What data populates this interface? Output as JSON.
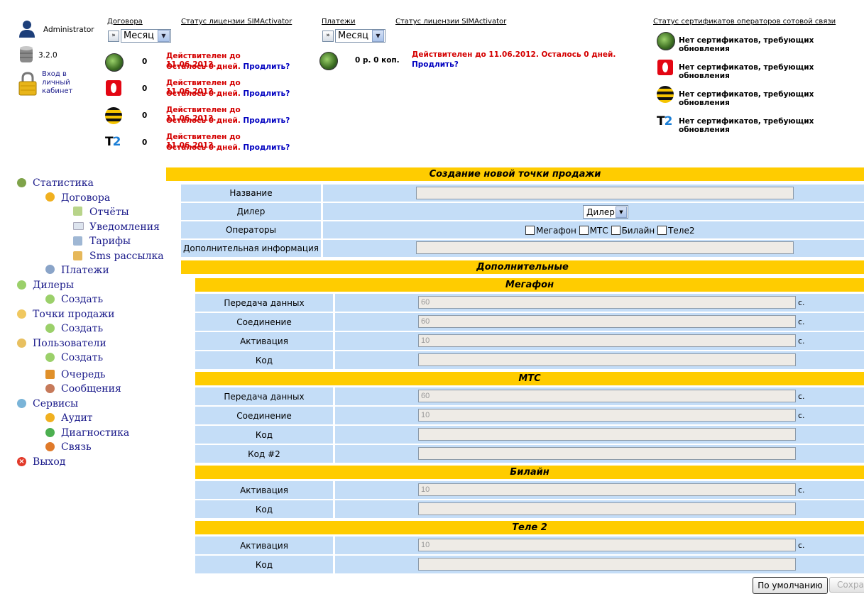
{
  "user": {
    "name": "Administrator",
    "version": "3.2.0",
    "cabinet_link": [
      "Вход в",
      "личный",
      "кабинет"
    ]
  },
  "contracts": {
    "title": "Договора",
    "license_title": "Статус лицензии SIMActivator",
    "period": "Месяц",
    "rows": [
      {
        "operator": "megafon",
        "count": "0",
        "line1": "Действителен до 11.06.2012.",
        "line2": "Осталось 0 дней.",
        "renew": "Продлить?"
      },
      {
        "operator": "mts",
        "count": "0",
        "line1": "Действителен до 11.06.2012.",
        "line2": "Осталось 0 дней.",
        "renew": "Продлить?"
      },
      {
        "operator": "beeline",
        "count": "0",
        "line1": "Действителен до 11.06.2012.",
        "line2": "Осталось 0 дней.",
        "renew": "Продлить?"
      },
      {
        "operator": "tele2",
        "count": "0",
        "line1": "Действителен до 11.06.2012.",
        "line2": "Осталось 0 дней.",
        "renew": "Продлить?"
      }
    ]
  },
  "payments": {
    "title": "Платежи",
    "license_title": "Статус лицензии SIMActivator",
    "period": "Месяц",
    "amount": "0 р. 0 коп.",
    "line1": "Действителен до 11.06.2012. Осталось 0 дней.",
    "renew": "Продлить?"
  },
  "certificates": {
    "title": "Статус сертификатов операторов сотовой связи",
    "rows": [
      "Нет сертификатов, требующих обновления",
      "Нет сертификатов, требующих обновления",
      "Нет сертификатов, требующих обновления",
      "Нет сертификатов, требующих обновления"
    ]
  },
  "sidebar": {
    "statistics": "Статистика",
    "contracts": "Договора",
    "reports": "Отчёты",
    "notifications": "Уведомления",
    "tariffs": "Тарифы",
    "sms": "Sms рассылка",
    "payments": "Платежи",
    "dealers": "Дилеры",
    "dealers_create": "Создать",
    "points": "Точки продажи",
    "points_create": "Создать",
    "users": "Пользователи",
    "users_create": "Создать",
    "queue": "Очередь",
    "messages": "Сообщения",
    "services": "Сервисы",
    "audit": "Аудит",
    "diagnostics": "Диагностика",
    "link": "Связь",
    "exit": "Выход"
  },
  "form": {
    "title": "Создание новой точки продажи",
    "name_label": "Название",
    "name_value": "",
    "dealer_label": "Дилер",
    "dealer_select": "Дилер",
    "operators_label": "Операторы",
    "operators": [
      "Мегафон",
      "МТС",
      "Билайн",
      "Теле2"
    ],
    "info_label": "Дополнительная информация",
    "info_value": "",
    "extra_title": "Дополнительные",
    "megafon": {
      "title": "Мегафон",
      "data_label": "Передача данных",
      "data_value": "60",
      "data_unit": "с.",
      "conn_label": "Соединение",
      "conn_value": "60",
      "conn_unit": "с.",
      "act_label": "Активация",
      "act_value": "10",
      "act_unit": "с.",
      "code_label": "Код",
      "code_value": ""
    },
    "mts": {
      "title": "МТС",
      "data_label": "Передача данных",
      "data_value": "60",
      "data_unit": "с.",
      "conn_label": "Соединение",
      "conn_value": "10",
      "conn_unit": "с.",
      "code_label": "Код",
      "code_value": "",
      "code2_label": "Код #2",
      "code2_value": ""
    },
    "beeline": {
      "title": "Билайн",
      "act_label": "Активация",
      "act_value": "10",
      "act_unit": "с.",
      "code_label": "Код",
      "code_value": ""
    },
    "tele2": {
      "title": "Теле 2",
      "act_label": "Активация",
      "act_value": "10",
      "act_unit": "с.",
      "code_label": "Код",
      "code_value": ""
    },
    "default_button": "По умолчанию",
    "save_button": "Сохранить"
  }
}
